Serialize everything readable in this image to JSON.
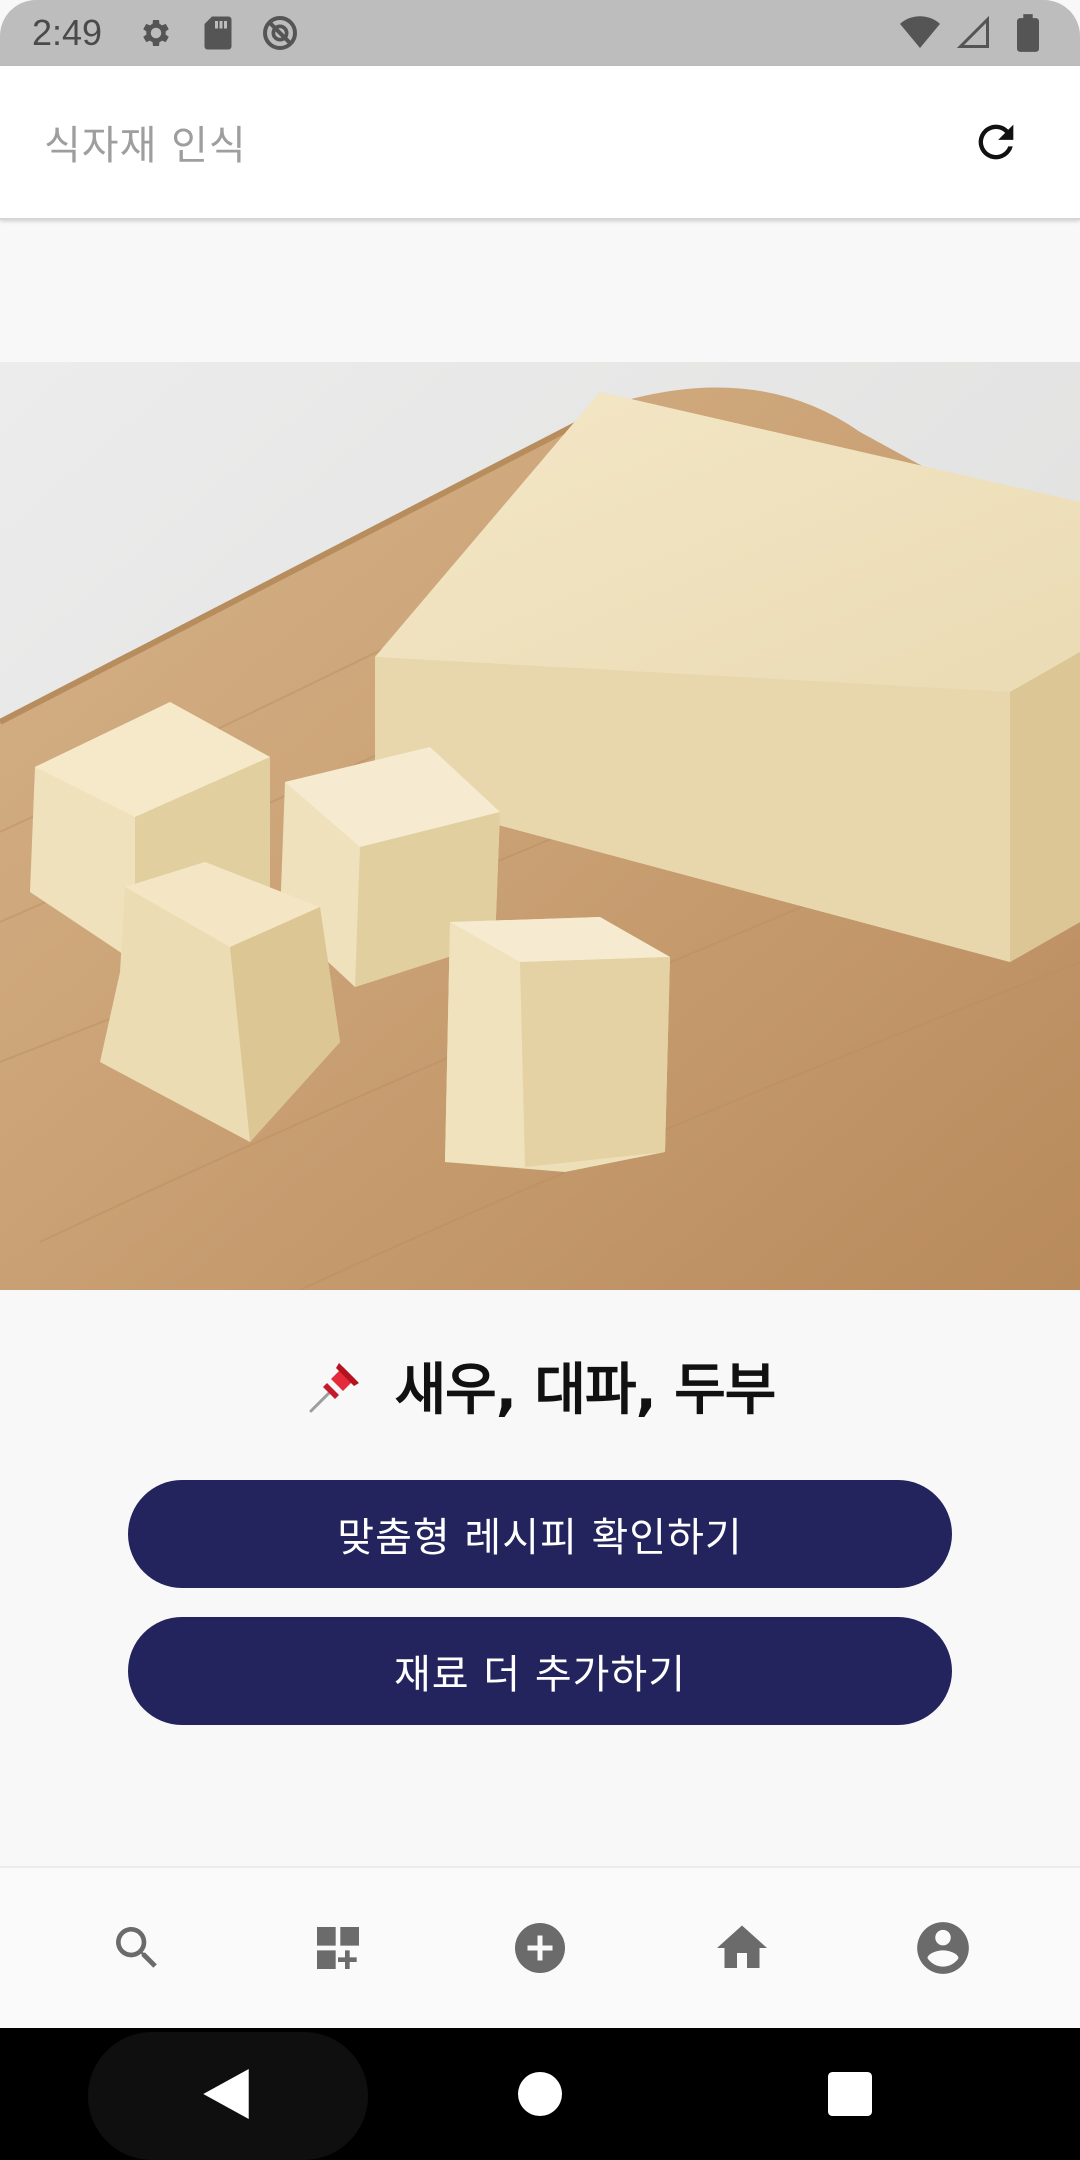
{
  "status_bar": {
    "time": "2:49",
    "left_icons": [
      "gear-icon",
      "sd-card-icon",
      "no-disturb-icon"
    ],
    "right_icons": [
      "wifi-icon",
      "signal-icon",
      "battery-icon"
    ]
  },
  "app_bar": {
    "title": "식자재 인식",
    "refresh_icon": "refresh-icon"
  },
  "photo": {
    "subject": "tofu-on-cutting-board"
  },
  "result": {
    "pin_icon": "pushpin-icon",
    "ingredients": "새우, 대파, 두부"
  },
  "buttons": {
    "recipe_label": "맞춤형 레시피 확인하기",
    "add_label": "재료 더 추가하기"
  },
  "bottom_nav": {
    "items": [
      {
        "icon": "search-icon"
      },
      {
        "icon": "grid-add-icon"
      },
      {
        "icon": "add-circle-icon"
      },
      {
        "icon": "home-icon"
      },
      {
        "icon": "account-icon"
      }
    ]
  },
  "system_nav": {
    "icons": [
      "back-icon",
      "home-circle-icon",
      "recents-icon"
    ]
  },
  "colors": {
    "button_bg": "#23245e",
    "status_bar": "#bdbdbd",
    "nav_icon": "#6b6b6b"
  }
}
